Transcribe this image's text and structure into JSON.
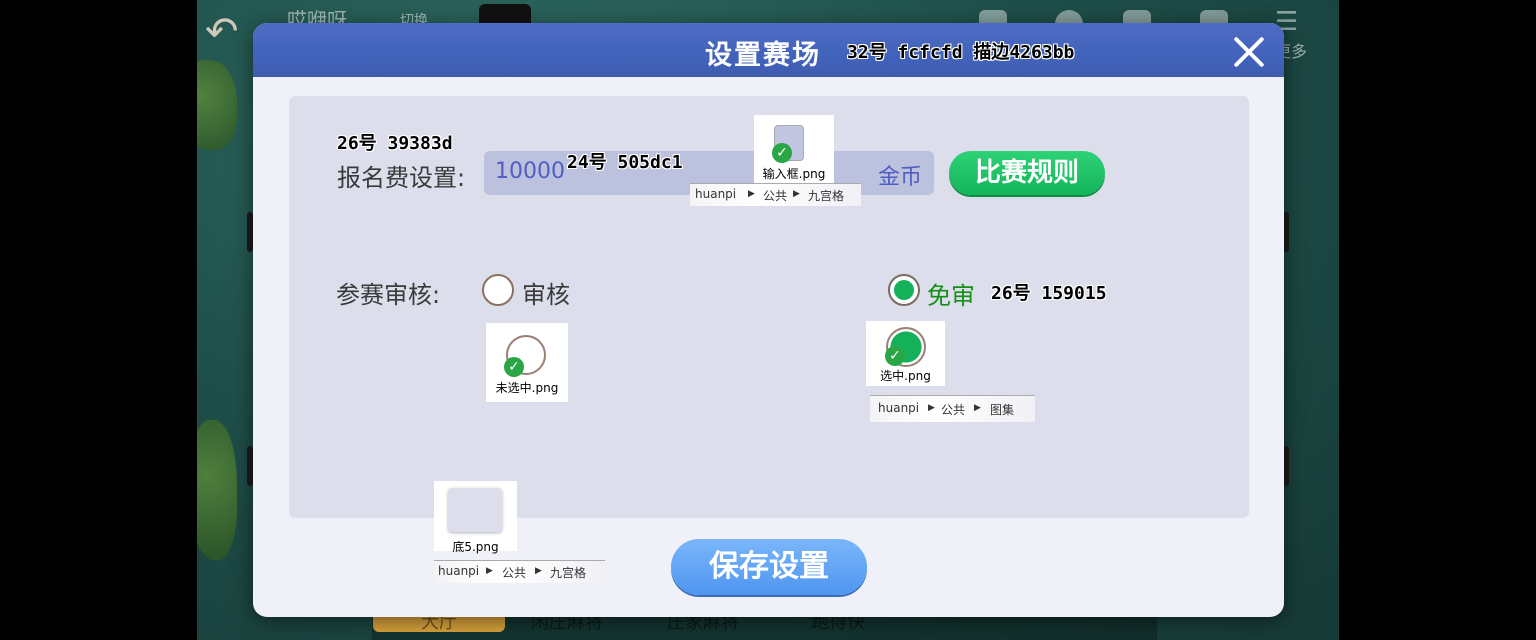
{
  "background": {
    "game_title": "哎咿呀",
    "switch_label": "切换",
    "more_label": "更多",
    "tabs": [
      "大厅",
      "闲庄麻将",
      "庄家麻将",
      "跑得快"
    ]
  },
  "dialog": {
    "title": "设置赛场",
    "title_annotation": "32号 fcfcfd 描边4263bb",
    "colors": {
      "header": "#4263bb",
      "title_text": "#fcfcfd",
      "label_text": "#39383d",
      "input_text": "#505dc1",
      "selected_text": "#159015"
    }
  },
  "fee": {
    "annotation": "26号 39383d",
    "label": "报名费设置:",
    "value": "10000",
    "value_annotation": "24号 505dc1",
    "unit": "金币",
    "rules_button": "比赛规则"
  },
  "review": {
    "label": "参赛审核:",
    "option_review": "审核",
    "option_free": "免审",
    "selected": "免审",
    "free_annotation": "26号 159015"
  },
  "assets": {
    "input_box": {
      "file": "输入框.png",
      "crumb": [
        "huanpi",
        "公共",
        "九宫格"
      ]
    },
    "unselected": {
      "file": "未选中.png"
    },
    "selected": {
      "file": "选中.png",
      "crumb": [
        "huanpi",
        "公共",
        "图集"
      ]
    },
    "base": {
      "file": "底5.png",
      "crumb": [
        "huanpi",
        "公共",
        "九宫格"
      ]
    }
  },
  "save_button": "保存设置"
}
